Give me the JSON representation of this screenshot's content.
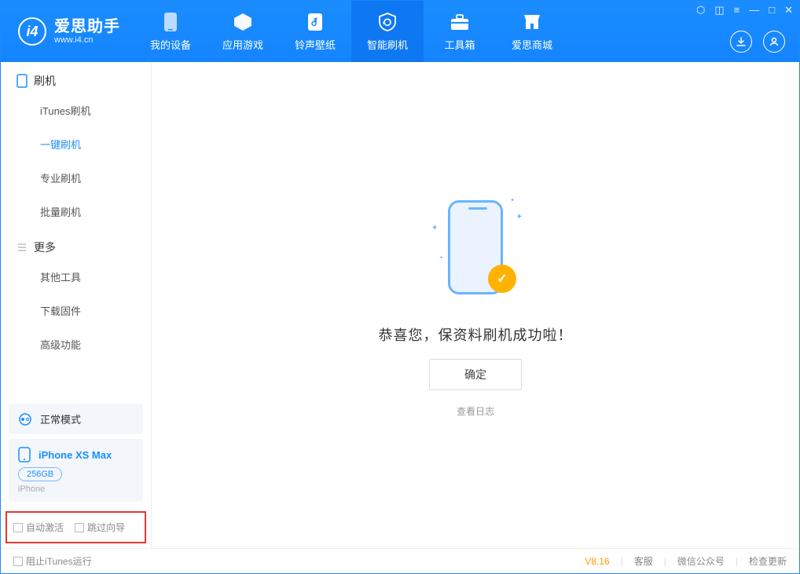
{
  "brand": {
    "name": "爱思助手",
    "sub": "www.i4.cn"
  },
  "tabs": [
    {
      "label": "我的设备"
    },
    {
      "label": "应用游戏"
    },
    {
      "label": "铃声壁纸"
    },
    {
      "label": "智能刷机"
    },
    {
      "label": "工具箱"
    },
    {
      "label": "爱思商城"
    }
  ],
  "sidebar": {
    "group1": {
      "title": "刷机",
      "items": [
        "iTunes刷机",
        "一键刷机",
        "专业刷机",
        "批量刷机"
      ]
    },
    "group2": {
      "title": "更多",
      "items": [
        "其他工具",
        "下载固件",
        "高级功能"
      ]
    }
  },
  "mode_box": {
    "label": "正常模式"
  },
  "device": {
    "name": "iPhone XS Max",
    "storage": "256GB",
    "type": "iPhone"
  },
  "options": {
    "auto_activate": "自动激活",
    "skip_guide": "跳过向导"
  },
  "main": {
    "success": "恭喜您，保资料刷机成功啦！",
    "ok": "确定",
    "log": "查看日志"
  },
  "footer": {
    "block_itunes": "阻止iTunes运行",
    "version": "V8.16",
    "links": [
      "客服",
      "微信公众号",
      "检查更新"
    ]
  }
}
